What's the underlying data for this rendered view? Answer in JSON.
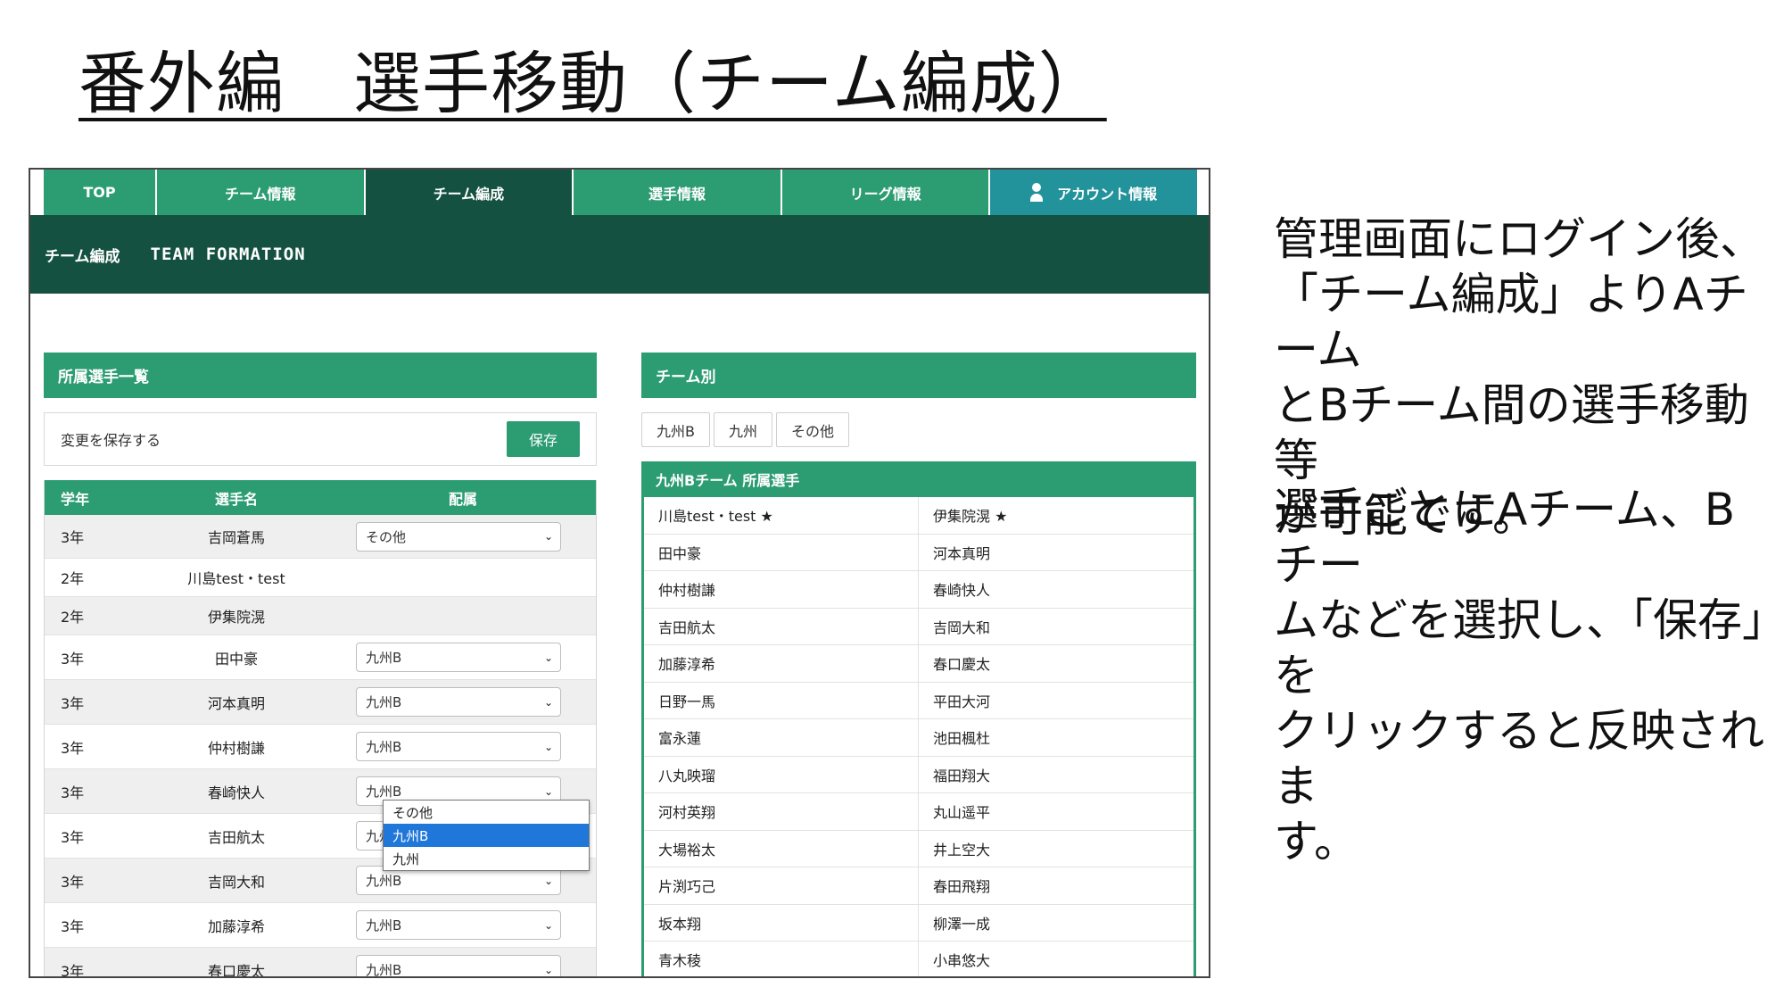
{
  "slide": {
    "title": "番外編　選手移動（チーム編成）",
    "desc1_lines": [
      "管理画面にログイン後、",
      "「チーム編成」よりAチーム",
      "とBチーム間の選手移動等",
      "が可能です。"
    ],
    "desc2_lines": [
      "選手ごとにAチーム、Bチー",
      "ムなどを選択し、「保存」を",
      "クリックすると反映されま",
      "す。"
    ]
  },
  "nav": {
    "tabs": [
      "TOP",
      "チーム情報",
      "チーム編成",
      "選手情報",
      "リーグ情報",
      "アカウント情報"
    ],
    "active": "チーム編成"
  },
  "banner": {
    "jp": "チーム編成",
    "en": "TEAM FORMATION"
  },
  "roster": {
    "header": "所属選手一覧",
    "save_text": "変更を保存する",
    "save_button": "保存",
    "columns": [
      "学年",
      "選手名",
      "配属"
    ],
    "rows": [
      {
        "grade": "3年",
        "name": "吉岡蒼馬",
        "assign": "その他"
      },
      {
        "grade": "2年",
        "name": "川島test・test",
        "assign": null
      },
      {
        "grade": "2年",
        "name": "伊集院滉",
        "assign": null
      },
      {
        "grade": "3年",
        "name": "田中豪",
        "assign": "九州B"
      },
      {
        "grade": "3年",
        "name": "河本真明",
        "assign": "九州B"
      },
      {
        "grade": "3年",
        "name": "仲村樹謙",
        "assign": "九州B"
      },
      {
        "grade": "3年",
        "name": "春崎快人",
        "assign": "九州B"
      },
      {
        "grade": "3年",
        "name": "吉田航太",
        "assign": "九州B"
      },
      {
        "grade": "3年",
        "name": "吉岡大和",
        "assign": "九州B"
      },
      {
        "grade": "3年",
        "name": "加藤淳希",
        "assign": "九州B"
      },
      {
        "grade": "3年",
        "name": "春口慶太",
        "assign": "九州B"
      }
    ],
    "dropdown": {
      "options": [
        "その他",
        "九州B",
        "九州"
      ],
      "highlighted": "九州B"
    }
  },
  "teams": {
    "header": "チーム別",
    "filters": [
      "九州B",
      "九州",
      "その他"
    ],
    "team_header": "九州Bチーム 所属選手",
    "players": [
      [
        "川島test・test ★",
        "伊集院滉 ★"
      ],
      [
        "田中豪",
        "河本真明"
      ],
      [
        "仲村樹謙",
        "春崎快人"
      ],
      [
        "吉田航太",
        "吉岡大和"
      ],
      [
        "加藤淳希",
        "春口慶太"
      ],
      [
        "日野一馬",
        "平田大河"
      ],
      [
        "富永蓮",
        "池田楓杜"
      ],
      [
        "八丸映瑠",
        "福田翔大"
      ],
      [
        "河村英翔",
        "丸山遥平"
      ],
      [
        "大場裕太",
        "井上空大"
      ],
      [
        "片渕巧己",
        "春田飛翔"
      ],
      [
        "坂本翔",
        "柳澤一成"
      ],
      [
        "青木稜",
        "小串悠大"
      ]
    ]
  },
  "colors": {
    "primary": "#2c9c73",
    "dark": "#145140",
    "account": "#23939b",
    "highlight": "#1e77d9"
  }
}
